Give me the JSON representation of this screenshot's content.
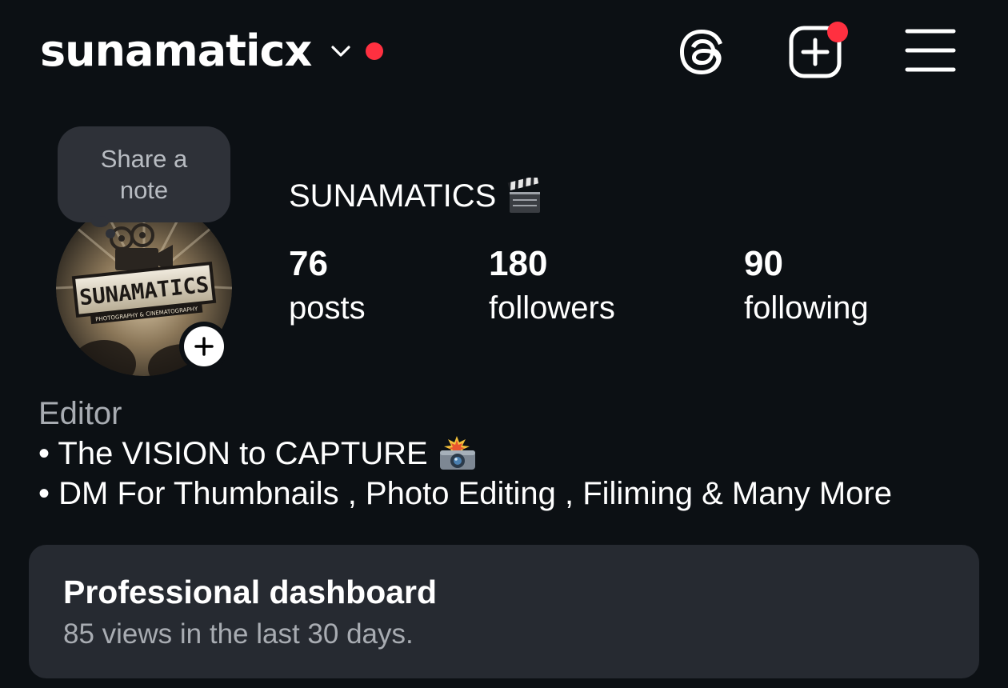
{
  "header": {
    "username": "sunamaticx",
    "chevron_icon": "chevron-down-icon",
    "status_dot_color": "#ff3040",
    "actions": [
      {
        "name": "threads-icon"
      },
      {
        "name": "create-post-icon",
        "badge_color": "#ff3040"
      },
      {
        "name": "menu-icon"
      }
    ]
  },
  "profile": {
    "note_placeholder": "Share a note",
    "display_name": "SUNAMATICS",
    "display_name_emoji": "clapper-board",
    "avatar_text": "SUNAMATICS",
    "avatar_subtext": "PHOTOGRAPHY & CINEMATOGRAPHY",
    "stats": {
      "posts": {
        "value": "76",
        "label": "posts"
      },
      "followers": {
        "value": "180",
        "label": "followers"
      },
      "following": {
        "value": "90",
        "label": "following"
      }
    }
  },
  "bio": {
    "category": "Editor",
    "lines": [
      {
        "text": "• The VISION to CAPTURE",
        "emoji": "camera-with-flash"
      },
      {
        "text": "• DM For Thumbnails , Photo Editing , Filiming & Many More"
      }
    ]
  },
  "dashboard": {
    "title": "Professional dashboard",
    "subtitle": "85 views in the last 30 days."
  },
  "colors": {
    "background": "#0c1014",
    "card": "#262a31",
    "note_bubble": "#2e3138",
    "muted_text": "#a8acb2",
    "notification_red": "#ff3040"
  }
}
